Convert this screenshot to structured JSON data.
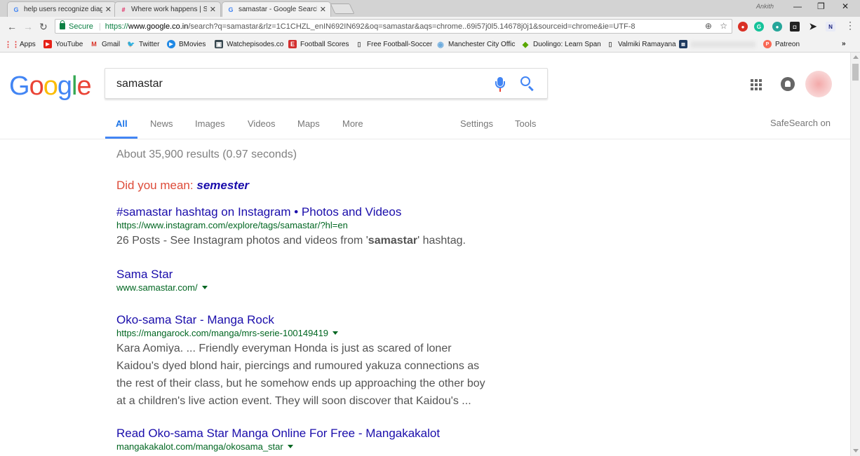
{
  "browser": {
    "tabs": [
      {
        "title": "help users recognize diag",
        "favicon": "G",
        "active": false
      },
      {
        "title": "Where work happens | Sl",
        "favicon": "slack-icon",
        "active": false
      },
      {
        "title": "samastar - Google Search",
        "favicon": "G",
        "active": true
      }
    ],
    "profile_name": "Ankith",
    "omnibox": {
      "secure_label": "Secure",
      "url_scheme": "https://",
      "url_host": "www.google.co.in",
      "url_path": "/search?q=samastar&rlz=1C1CHZL_enIN692IN692&oq=samastar&aqs=chrome..69i57j0l5.14678j0j1&sourceid=chrome&ie=UTF-8"
    },
    "bookmarks": [
      {
        "label": "Apps",
        "icon": "apps-grid-icon",
        "color": "#e53935"
      },
      {
        "label": "YouTube",
        "icon": "youtube-icon",
        "color": "#e62117"
      },
      {
        "label": "Gmail",
        "icon": "gmail-icon",
        "color": "#d93025"
      },
      {
        "label": "Twitter",
        "icon": "twitter-icon",
        "color": "#1da1f2"
      },
      {
        "label": "BMovies",
        "icon": "play-icon",
        "color": "#1e88e5"
      },
      {
        "label": "Watchepisodes.co",
        "icon": "tv-icon",
        "color": "#37474f"
      },
      {
        "label": "Football Scores",
        "icon": "espn-icon",
        "color": "#d32f2f"
      },
      {
        "label": "Free Football-Soccer",
        "icon": "page-icon",
        "color": "#555555"
      },
      {
        "label": "Manchester City Offic",
        "icon": "crest-icon",
        "color": "#6cabdd"
      },
      {
        "label": "Duolingo: Learn Span",
        "icon": "duolingo-icon",
        "color": "#58a700"
      },
      {
        "label": "Valmiki Ramayana",
        "icon": "page-icon",
        "color": "#555555"
      },
      {
        "label": "Patreon",
        "icon": "patreon-icon",
        "color": "#f96854"
      }
    ]
  },
  "google": {
    "logo": "Google",
    "query": "samastar",
    "tabs": [
      "All",
      "News",
      "Images",
      "Videos",
      "Maps",
      "More"
    ],
    "settings": "Settings",
    "tools": "Tools",
    "safesearch": "SafeSearch on",
    "stats": "About 35,900 results (0.97 seconds)",
    "did_you_mean_label": "Did you mean:",
    "did_you_mean_term": "semester",
    "results": [
      {
        "title": "#samastar hashtag on Instagram • Photos and Videos",
        "url": "https://www.instagram.com/explore/tags/samastar/?hl=en",
        "snippet_before": "26 Posts - See Instagram photos and videos from '",
        "snippet_bold": "samastar",
        "snippet_after": "' hashtag.",
        "caret": false
      },
      {
        "title": "Sama Star",
        "url": "www.samastar.com/",
        "snippet": "",
        "caret": true
      },
      {
        "title": "Oko-sama Star - Manga Rock",
        "url": "https://mangarock.com/manga/mrs-serie-100149419",
        "snippet_lines": [
          "Kara Aomiya. ... Friendly everyman Honda is just as scared of loner",
          "Kaidou's dyed blond hair, piercings and rumoured yakuza connections as",
          "the rest of their class, but he somehow ends up approaching the other boy",
          "at a children's live action event. They will soon discover that Kaidou's ..."
        ],
        "caret": true
      },
      {
        "title": "Read Oko-sama Star Manga Online For Free - Mangakakalot",
        "url": "mangakakalot.com/manga/okosama_star",
        "caret": true
      }
    ]
  },
  "colors": {
    "link": "#1a0dab",
    "url_green": "#006621",
    "snippet": "#545454",
    "did_you_mean": "#dd4b39",
    "accent_blue": "#4285f4"
  }
}
